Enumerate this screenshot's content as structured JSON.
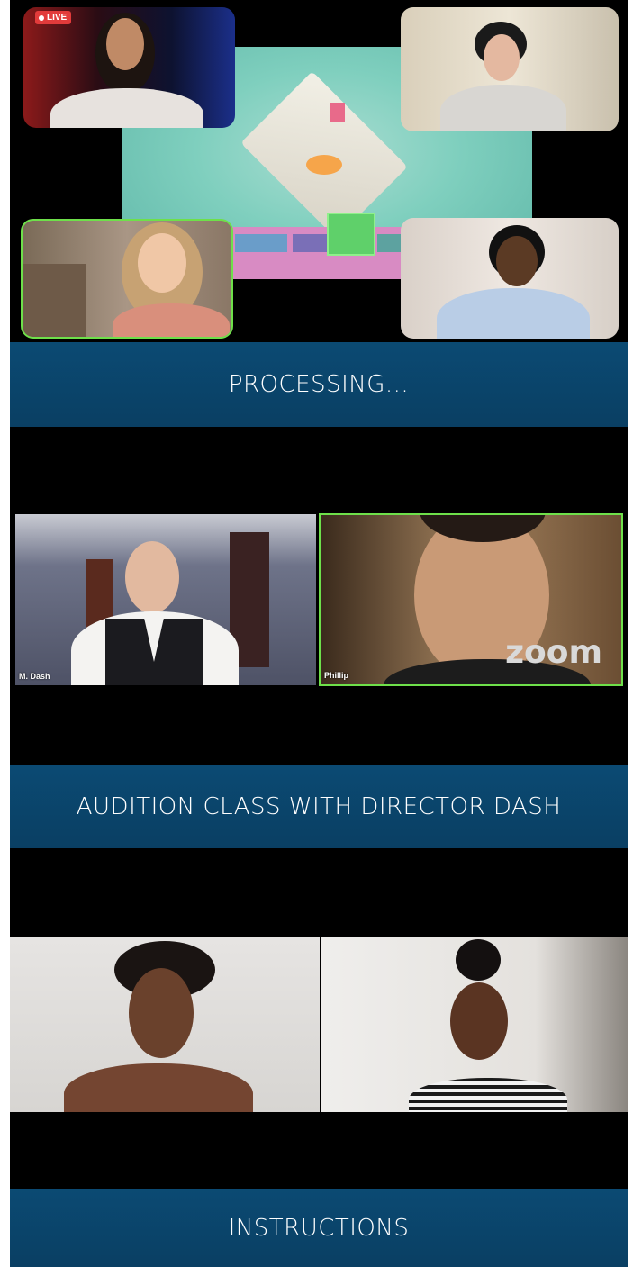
{
  "section1": {
    "live_badge": "LIVE",
    "caption": "PROCESSING..."
  },
  "section2": {
    "tile_left_name": "M. Dash",
    "tile_right_name": "Phillip",
    "logo": "zoom",
    "caption": "AUDITION CLASS WITH DIRECTOR DASH"
  },
  "section3": {
    "caption": "INSTRUCTIONS"
  },
  "colors": {
    "caption_blue": "#0b4a73",
    "active_speaker_green": "#6ee04a",
    "live_red": "#e23b3b"
  }
}
